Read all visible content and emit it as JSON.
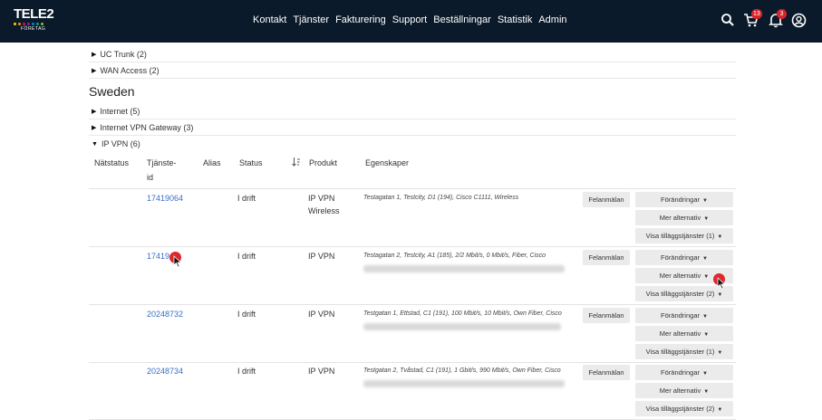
{
  "brand": {
    "logo_text": "TELE2",
    "logo_sub": "FÖRETAG",
    "dot_colors": [
      "#ffd400",
      "#f39200",
      "#e6007e",
      "#7a2a8f",
      "#0089cf",
      "#00a19a",
      "#95c11f"
    ]
  },
  "nav": {
    "items": [
      "Kontakt",
      "Tjänster",
      "Fakturering",
      "Support",
      "Beställningar",
      "Statistik",
      "Admin"
    ]
  },
  "header_icons": {
    "cart_badge": "13",
    "bell_badge": "3"
  },
  "groups_top": [
    {
      "label": "UC Trunk (2)"
    },
    {
      "label": "WAN Access (2)"
    }
  ],
  "country": "Sweden",
  "groups_sweden": [
    {
      "label": "Internet (5)"
    },
    {
      "label": "Internet VPN Gateway (3)"
    },
    {
      "label": "IP VPN (6)"
    }
  ],
  "table": {
    "headers": {
      "netstatus": "Nätstatus",
      "service_id_1": "Tjänste-",
      "service_id_2": "id",
      "alias": "Alias",
      "status": "Status",
      "sort_icon": "sort-icon",
      "product": "Produkt",
      "properties": "Egenskaper"
    },
    "rows": [
      {
        "service_id": "17419064",
        "status": "I drift",
        "product_1": "IP VPN",
        "product_2": "Wireless",
        "properties": "Testagatan 1, Testcity, D1 (194), Cisco C1111, Wireless",
        "report_btn": "Felanmälan",
        "changes_btn": "Förändringar",
        "more_btn": "Mer alternativ",
        "addons_btn": "Visa tilläggstjänster (1)"
      },
      {
        "service_id": "17419",
        "status": "I drift",
        "product_1": "IP VPN",
        "product_2": "",
        "properties": "Testagatan 2, Testcity, A1 (185), 2/2 Mbit/s, 0 Mbit/s, Fiber, Cisco",
        "report_btn": "Felanmälan",
        "changes_btn": "Förändringar",
        "more_btn": "Mer alternativ",
        "addons_btn": "Visa tilläggstjänster (2)"
      },
      {
        "service_id": "20248732",
        "status": "I drift",
        "product_1": "IP VPN",
        "product_2": "",
        "properties": "Testgatan 1, Ettstad, C1 (191), 100 Mbit/s, 10 Mbit/s, Own Fiber, Cisco",
        "report_btn": "Felanmälan",
        "changes_btn": "Förändringar",
        "more_btn": "Mer alternativ",
        "addons_btn": "Visa tilläggstjänster (1)"
      },
      {
        "service_id": "20248734",
        "status": "I drift",
        "product_1": "IP VPN",
        "product_2": "",
        "properties": "Testgatan 2, Tvåstad, C1 (191), 1 Gbit/s, 990 Mbit/s, Own Fiber, Cisco",
        "report_btn": "Felanmälan",
        "changes_btn": "Förändringar",
        "more_btn": "Mer alternativ",
        "addons_btn": "Visa tilläggstjänster (2)"
      }
    ]
  },
  "colors": {
    "header_bg": "#0b1a2a",
    "link": "#3b6fc4",
    "badge": "#d8242d",
    "cursor": "#e0262d"
  }
}
